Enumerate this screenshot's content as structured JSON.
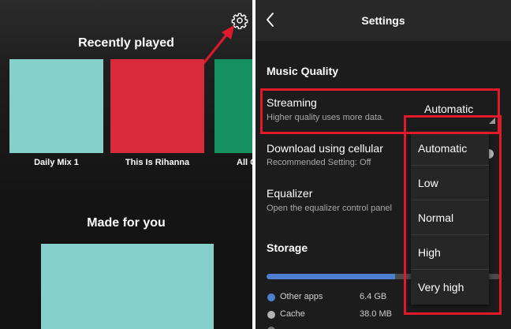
{
  "left": {
    "recently_played_title": "Recently played",
    "tiles": [
      {
        "label": "Daily Mix 1",
        "color": "#86d0cc"
      },
      {
        "label": "This Is Rihanna",
        "color": "#d72a3a"
      },
      {
        "label": "All C",
        "color": "#15915f"
      }
    ],
    "made_for_you_title": "Made for you",
    "made_for_you_tile_color": "#86d0cc",
    "gear_icon": "gear-icon",
    "annotation_color": "#e0192b"
  },
  "right": {
    "header_title": "Settings",
    "back_icon": "chevron-left-icon",
    "music_quality_heading": "Music Quality",
    "streaming": {
      "title": "Streaming",
      "subtitle": "Higher quality uses more data.",
      "selected_value": "Automatic"
    },
    "download": {
      "title": "Download using cellular",
      "subtitle": "Recommended Setting: Off"
    },
    "equalizer": {
      "title": "Equalizer",
      "subtitle": "Open the equalizer control panel"
    },
    "quality_options": [
      "Automatic",
      "Low",
      "Normal",
      "High",
      "Very high"
    ],
    "storage_heading": "Storage",
    "storage_used_fraction": 0.55,
    "storage_items": [
      {
        "label": "Other apps",
        "size": "6.4 GB",
        "color": "#4d7fd1"
      },
      {
        "label": "Cache",
        "size": "38.0 MB",
        "color": "#b3b3b3"
      }
    ]
  }
}
